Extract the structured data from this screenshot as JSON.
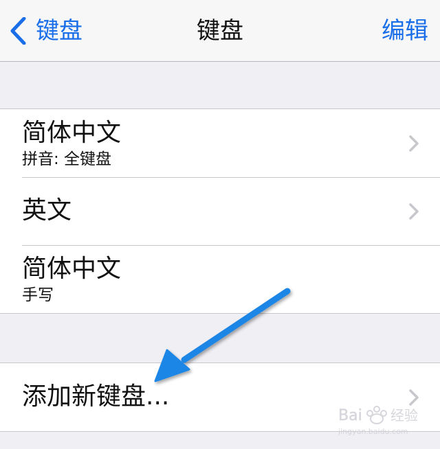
{
  "navbar": {
    "back_label": "键盘",
    "title": "键盘",
    "edit_label": "编辑"
  },
  "keyboards": [
    {
      "title": "简体中文",
      "subtitle": "拼音: 全键盘",
      "has_chevron": true
    },
    {
      "title": "英文",
      "subtitle": "",
      "has_chevron": true
    },
    {
      "title": "简体中文",
      "subtitle": "手写",
      "has_chevron": false
    }
  ],
  "add_keyboard": {
    "label": "添加新键盘..."
  },
  "watermark": {
    "brand": "Bai 经验",
    "url": "jingyan.baidu.com"
  },
  "colors": {
    "accent": "#1a6ee8",
    "arrow": "#1f86e6",
    "chevron": "#c7c7cc",
    "background": "#efeff4"
  },
  "icons": {
    "back": "chevron-left-icon",
    "disclosure": "chevron-right-icon",
    "annotation": "pointer-arrow"
  }
}
